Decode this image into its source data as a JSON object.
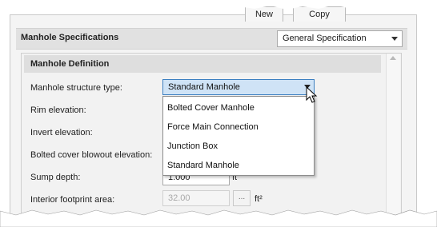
{
  "toolbar": {
    "new_label": "New",
    "copy_label": "Copy"
  },
  "spec_section": {
    "title": "Manhole Specifications",
    "dropdown_value": "General Specification"
  },
  "definition": {
    "title": "Manhole Definition",
    "fields": [
      {
        "label": "Manhole structure type:"
      },
      {
        "label": "Rim elevation:"
      },
      {
        "label": "Invert elevation:"
      },
      {
        "label": "Bolted cover blowout elevation:"
      },
      {
        "label": "Sump depth:",
        "value": "1.000",
        "unit": "ft"
      },
      {
        "label": "Interior footprint area:",
        "value": "32.00",
        "unit": "ft²",
        "browse": "..."
      }
    ]
  },
  "structure_combo": {
    "selected": "Standard Manhole",
    "options": [
      "Bolted Cover Manhole",
      "Force Main Connection",
      "Junction Box",
      "Standard Manhole"
    ]
  },
  "icons": [
    "dropdown-arrow-icon",
    "mouse-cursor-icon",
    "scroll-up-icon"
  ]
}
